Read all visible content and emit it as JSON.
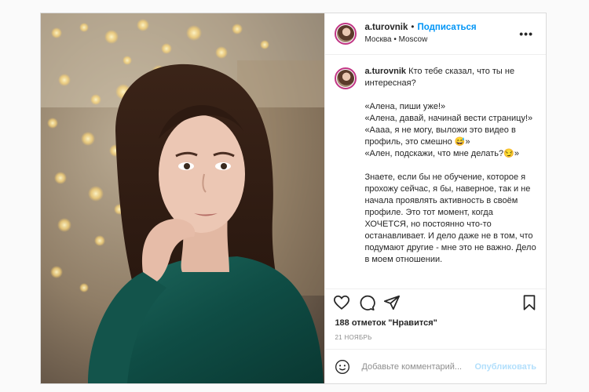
{
  "post": {
    "username": "a.turovnik",
    "follow_label": "Подписаться",
    "location": "Москва • Moscow",
    "more_label": "•••",
    "caption": {
      "username": "a.turovnik",
      "text": " Кто тебе сказал, что ты не интересная?\n\n«Алена, пиши уже!»\n«Алена, давай, начинай вести страницу!»\n«Аааа, я не могу, выложи это видео в профиль, это смешно 😅»\n«Ален, подскажи, что мне делать?😏»\n\nЗнаете, если бы не обучение, которое я прохожу сейчас, я бы, наверное, так и не начала проявлять активность в своём профиле. Это тот момент, когда ХОЧЕТСЯ, но постоянно что-то останавливает. И дело даже не в том, что подумают другие - мне это не важно. Дело в моем отношении."
    },
    "likes": "188 отметок \"Нравится\"",
    "date": "21 НОЯБРЬ",
    "comment": {
      "placeholder": "Добавьте комментарий...",
      "publish_label": "Опубликовать"
    },
    "icons": {
      "like": "heart-icon",
      "comment": "comment-icon",
      "share": "share-icon",
      "save": "bookmark-icon",
      "emoji": "emoji-icon"
    },
    "colors": {
      "accent": "#0095f6",
      "publish_disabled": "#b2dffc",
      "story_ring": "#c13584"
    }
  }
}
